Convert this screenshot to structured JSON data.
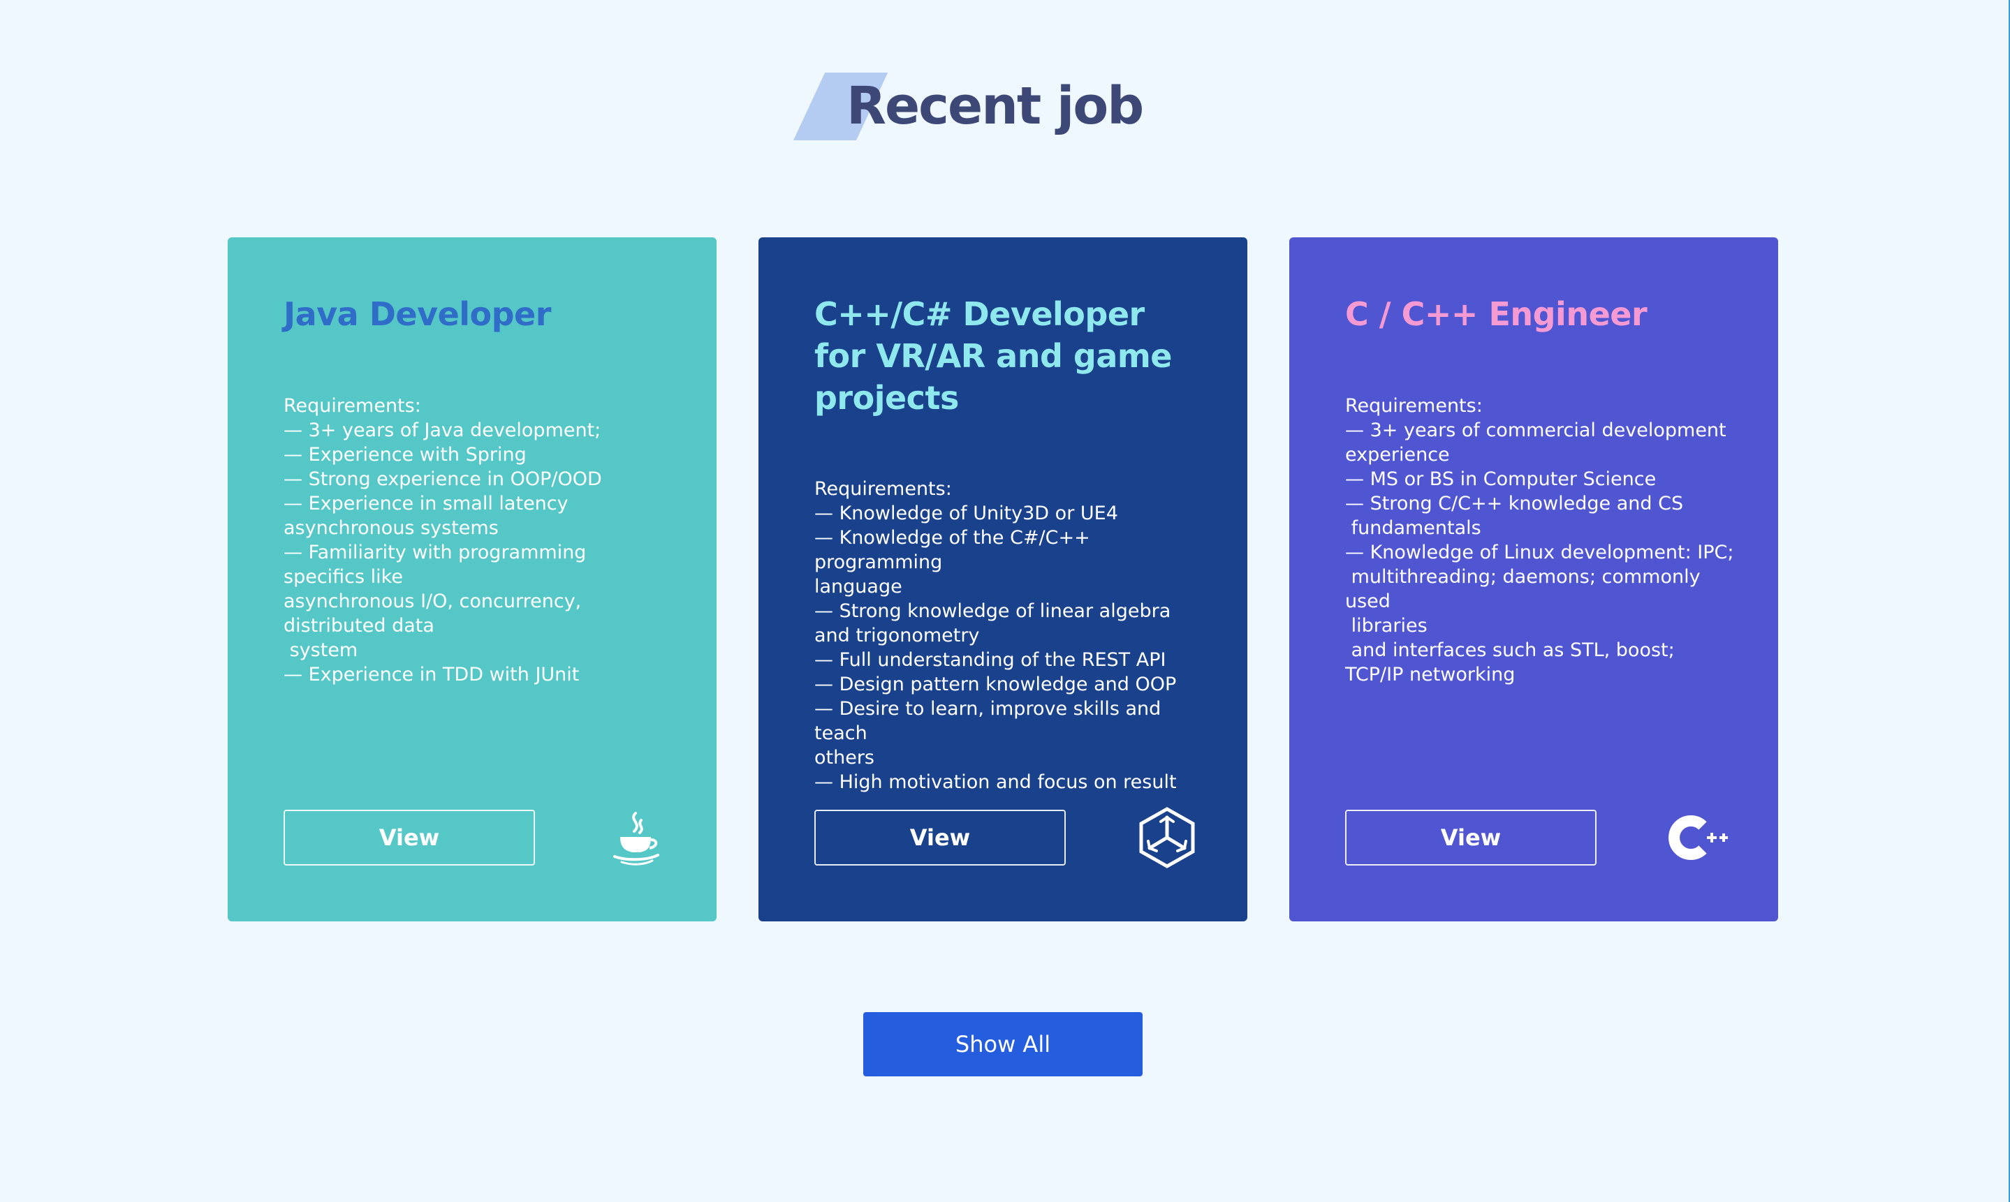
{
  "section": {
    "title": "Recent job"
  },
  "jobs": [
    {
      "title": "Java Developer",
      "requirements": "Requirements:\n— 3+ years of Java development;\n— Experience with Spring\n— Strong experience in OOP/OOD\n— Experience in small latency\nasynchronous systems\n— Familiarity with programming\nspecifics like\nasynchronous I/O, concurrency,\ndistributed data\n system\n— Experience in TDD with JUnit",
      "view_label": "View",
      "icon": "java-icon",
      "color": "#55c7c7",
      "title_color": "#2f6dc9"
    },
    {
      "title": "C++/C# Developer for VR/AR and game projects",
      "requirements": "Requirements:\n— Knowledge of Unity3D or UE4\n— Knowledge of the C#/C++ programming\nlanguage\n— Strong knowledge of linear algebra\nand trigonometry\n— Full understanding of the REST API\n— Design pattern knowledge and OOP\n— Desire to learn, improve skills and teach\nothers\n— High motivation and focus on result",
      "view_label": "View",
      "icon": "unity-icon",
      "color": "#19418c",
      "title_color": "#8fe8ee"
    },
    {
      "title": "C / C++ Engineer",
      "requirements": "Requirements:\n— 3+ years of commercial development\nexperience\n— MS or BS in Computer Science\n— Strong C/C++ knowledge and CS\n fundamentals\n— Knowledge of Linux development: IPC;\n multithreading; daemons; commonly used\n libraries\n and interfaces such as STL, boost;\nTCP/IP networking",
      "view_label": "View",
      "icon": "cplusplus-icon",
      "color": "#5055d2",
      "title_color": "#f59ad2"
    }
  ],
  "show_all_label": "Show All",
  "colors": {
    "background": "#eff8fe",
    "heading": "#3d4877",
    "heading_accent": "#b4cbf2",
    "button_primary": "#245dde"
  }
}
